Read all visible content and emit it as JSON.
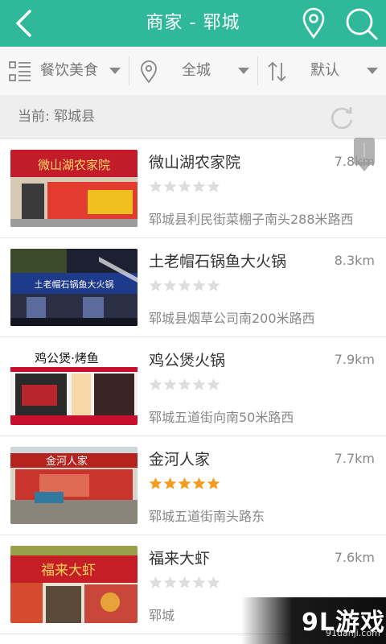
{
  "header": {
    "title": "商家 - 郓城",
    "back_icon": "back-arrow-icon",
    "location_icon": "location-pin-icon",
    "search_icon": "search-icon",
    "bg_color": "#2fb99a"
  },
  "filters": {
    "category": "餐饮美食",
    "area": "全城",
    "sort": "默认"
  },
  "current": {
    "label": "当前: 郓城县"
  },
  "merchants": [
    {
      "name": "微山湖农家院",
      "distance": "7.8km",
      "stars": 0,
      "address": "郓城县利民街菜棚子南头288米路西"
    },
    {
      "name": "土老帽石锅鱼大火锅",
      "distance": "8.3km",
      "stars": 0,
      "address": "郓城县烟草公司南200米路西"
    },
    {
      "name": "鸡公煲火锅",
      "distance": "7.9km",
      "stars": 0,
      "address": "郓城五道街向南50米路西"
    },
    {
      "name": "金河人家",
      "distance": "7.7km",
      "stars": 5,
      "address": "郓城五道街南头路东"
    },
    {
      "name": "福来大虾",
      "distance": "7.6km",
      "stars": 0,
      "address": "郓城"
    }
  ],
  "signs": [
    "微山湖农家院",
    "土老帽石锅鱼大火锅",
    "鸡公煲·烤鱼",
    "金河人家",
    "福来大虾"
  ],
  "watermark": {
    "logo": "9L游戏",
    "url": "91danji.com"
  },
  "colors": {
    "star_on": "#f39c1f",
    "star_off": "#dddddd",
    "accent": "#2fb99a"
  }
}
